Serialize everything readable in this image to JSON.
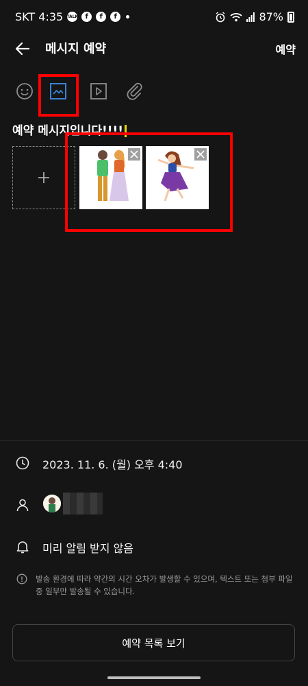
{
  "status_bar": {
    "carrier_time": "SKT 4:35",
    "talk_label": "TALK",
    "fb_label": "f",
    "battery": "87%"
  },
  "header": {
    "back_icon": "arrow-left-icon",
    "title": "메시지 예약",
    "action_label": "예약"
  },
  "toolbar": {
    "tools": [
      "emoji-icon",
      "image-icon",
      "video-icon",
      "attach-icon"
    ],
    "selected": "image-icon"
  },
  "message": {
    "text": "예약 메시지입니다!!!!"
  },
  "attachments": {
    "add_icon": "plus-icon",
    "images": [
      "image-couple",
      "image-girl"
    ],
    "remove_icon": "close-icon"
  },
  "schedule": {
    "datetime": "2023. 11. 6. (월) 오후 4:40"
  },
  "recipient": {
    "avatar": "avatar-image",
    "name_hidden": true
  },
  "alert": {
    "text": "미리 알림 받지 않음"
  },
  "notice": {
    "text": "발송 환경에 따라 약간의 시간 오차가 발생할 수 있으며, 텍스트 또는 첨부 파일 중 일부만 발송될 수 있습니다."
  },
  "footer": {
    "button_label": "예약 목록 보기"
  },
  "colors": {
    "background": "#151515",
    "highlight": "#ff0000",
    "accent": "#3b82d8",
    "caret": "#f1d500"
  }
}
